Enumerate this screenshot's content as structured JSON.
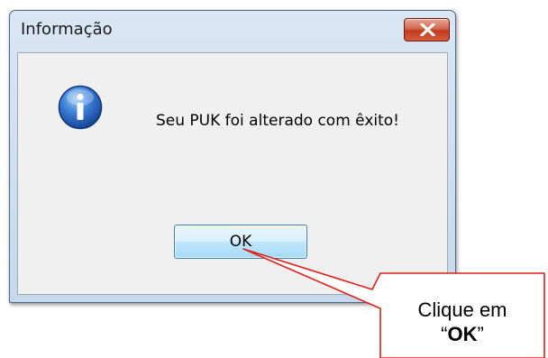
{
  "window": {
    "title": "Informação",
    "message": "Seu PUK foi alterado com êxito!",
    "ok_label": "OK"
  },
  "callout": {
    "line1": "Clique em",
    "line2_prefix": "“",
    "line2_bold": "OK",
    "line2_suffix": "”"
  },
  "icons": {
    "info": "info-icon",
    "close": "close-icon"
  },
  "colors": {
    "close_button": "#c13a20",
    "callout_border": "#e0201a",
    "info_icon": "#1f5fb8"
  }
}
